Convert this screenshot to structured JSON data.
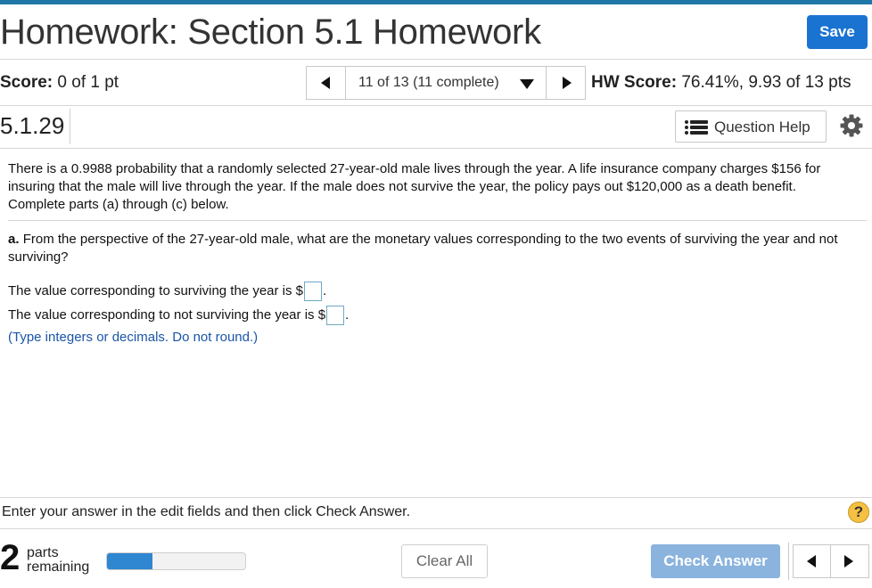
{
  "header": {
    "title": "Homework: Section 5.1 Homework",
    "save_label": "Save"
  },
  "status": {
    "score_label": "Score:",
    "score_value": "0 of 1 pt",
    "nav_label": "11 of 13 (11 complete)",
    "hw_score_label": "HW Score:",
    "hw_score_value": "76.41%, 9.93 of 13 pts"
  },
  "question": {
    "number": "5.1.29",
    "help_label": "Question Help",
    "text": "There is a 0.9988 probability that a randomly selected 27-year-old male lives through the year. A life insurance company charges $156 for insuring that the male will live through the year. If the male does not survive the year, the policy pays out $120,000 as a death benefit. Complete parts (a) through (c) below.",
    "part_label": "a.",
    "part_text": "From the perspective of the 27-year-old male, what are the monetary values corresponding to the two events of surviving the year and not surviving?",
    "answer1_prefix": "The value corresponding to surviving the year is $",
    "answer2_prefix": "The value corresponding to not surviving the year is $",
    "answer_suffix": ".",
    "answer1_value": "",
    "answer2_value": "",
    "hint": "(Type integers or decimals. Do not round.)"
  },
  "footer": {
    "instructions": "Enter your answer in the edit fields and then click Check Answer.",
    "help_glyph": "?",
    "parts_count": "2",
    "parts_word1": "parts",
    "parts_word2": "remaining",
    "progress_fraction": 0.33,
    "clear_label": "Clear All",
    "check_label": "Check Answer"
  },
  "icons": {
    "nav_prev": "triangle-left-icon",
    "nav_next": "triangle-right-icon",
    "nav_dropdown": "triangle-down-icon",
    "question_help": "list-icon",
    "settings": "gear-icon",
    "help": "question-circle-icon"
  },
  "colors": {
    "accent": "#1a73d1",
    "top_bar": "#1f77a8",
    "hint_text": "#1a55a8",
    "progress_fill": "#2f86d1",
    "check_button": "#8ab3dd",
    "help_circle": "#f6c142"
  }
}
